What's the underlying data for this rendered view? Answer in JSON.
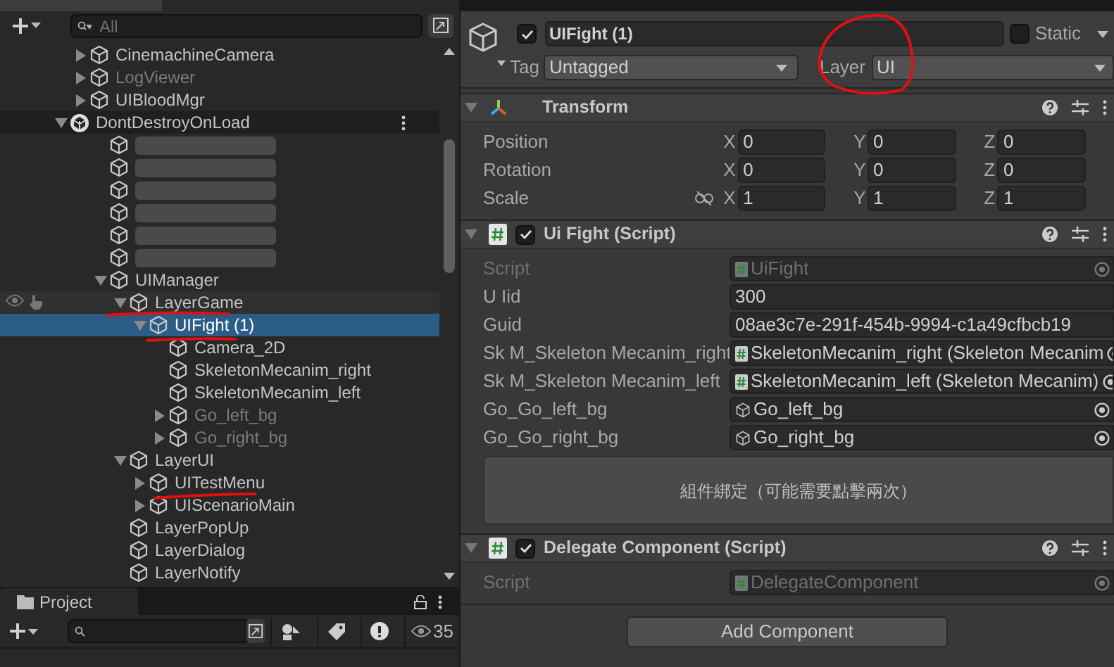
{
  "hierarchy": {
    "search": {
      "placeholder": "All"
    },
    "items": [
      {
        "kind": "object",
        "label": "CinemachineCamera",
        "expanded": false,
        "dimmed": false,
        "selected": false
      },
      {
        "kind": "object",
        "label": "LogViewer",
        "expanded": false,
        "dimmed": true,
        "selected": false
      },
      {
        "kind": "object",
        "label": "UIBloodMgr",
        "expanded": false,
        "dimmed": false,
        "selected": false
      },
      {
        "kind": "scene",
        "label": "DontDestroyOnLoad",
        "expanded": true,
        "dimmed": false,
        "selected": false,
        "children": [
          {
            "kind": "redacted"
          },
          {
            "kind": "redacted"
          },
          {
            "kind": "redacted"
          },
          {
            "kind": "redacted"
          },
          {
            "kind": "redacted"
          },
          {
            "kind": "redacted"
          },
          {
            "kind": "object",
            "label": "UIManager",
            "expanded": true,
            "dimmed": false,
            "selected": false,
            "children": [
              {
                "kind": "object",
                "label": "LayerGame",
                "expanded": true,
                "dimmed": false,
                "selected": false,
                "hovered": true,
                "children": [
                  {
                    "kind": "object",
                    "label": "UIFight (1)",
                    "expanded": true,
                    "dimmed": false,
                    "selected": true,
                    "children": [
                      {
                        "kind": "object",
                        "label": "Camera_2D",
                        "dimmed": false,
                        "selected": false
                      },
                      {
                        "kind": "object",
                        "label": "SkeletonMecanim_right",
                        "dimmed": false,
                        "selected": false
                      },
                      {
                        "kind": "object",
                        "label": "SkeletonMecanim_left",
                        "dimmed": false,
                        "selected": false
                      },
                      {
                        "kind": "object",
                        "label": "Go_left_bg",
                        "expanded": false,
                        "dimmed": true,
                        "selected": false
                      },
                      {
                        "kind": "object",
                        "label": "Go_right_bg",
                        "expanded": false,
                        "dimmed": true,
                        "selected": false
                      }
                    ]
                  }
                ]
              },
              {
                "kind": "object",
                "label": "LayerUI",
                "expanded": true,
                "dimmed": false,
                "selected": false,
                "children": [
                  {
                    "kind": "object",
                    "label": "UITestMenu",
                    "expanded": false,
                    "dimmed": false,
                    "selected": false
                  },
                  {
                    "kind": "object",
                    "label": "UIScenarioMain",
                    "expanded": false,
                    "dimmed": false,
                    "selected": false
                  }
                ]
              },
              {
                "kind": "object",
                "label": "LayerPopUp",
                "dimmed": false,
                "selected": false
              },
              {
                "kind": "object",
                "label": "LayerDialog",
                "dimmed": false,
                "selected": false
              },
              {
                "kind": "object",
                "label": "LayerNotify",
                "dimmed": false,
                "selected": false
              }
            ]
          }
        ]
      }
    ]
  },
  "project": {
    "tab": "Project",
    "count": "35"
  },
  "inspector": {
    "enabled": true,
    "name": "UIFight (1)",
    "static": false,
    "static_label": "Static",
    "tag_label": "Tag",
    "tag": "Untagged",
    "layer_label": "Layer",
    "layer": "UI",
    "transform": {
      "title": "Transform",
      "expanded": true,
      "rows": [
        {
          "label": "Position",
          "values": [
            {
              "axis": "X",
              "value": "0"
            },
            {
              "axis": "Y",
              "value": "0"
            },
            {
              "axis": "Z",
              "value": "0"
            }
          ]
        },
        {
          "label": "Rotation",
          "values": [
            {
              "axis": "X",
              "value": "0"
            },
            {
              "axis": "Y",
              "value": "0"
            },
            {
              "axis": "Z",
              "value": "0"
            }
          ]
        },
        {
          "label": "Scale",
          "proportional": false,
          "values": [
            {
              "axis": "X",
              "value": "1"
            },
            {
              "axis": "Y",
              "value": "1"
            },
            {
              "axis": "Z",
              "value": "1"
            }
          ]
        }
      ]
    },
    "components": [
      {
        "title": "Ui Fight (Script)",
        "enabled": true,
        "expanded": true,
        "fields": [
          {
            "kind": "script",
            "label": "Script",
            "value": "UiFight",
            "disabled": true
          },
          {
            "kind": "text",
            "label": "U Iid",
            "value": "300",
            "disabled": false
          },
          {
            "kind": "text",
            "label": "Guid",
            "value": "08ae3c7e-291f-454b-9994-c1a49cfbcb19",
            "disabled": false
          },
          {
            "kind": "component",
            "label": "Sk M_Skeleton Mecanim_right",
            "value": "SkeletonMecanim_right (Skeleton Mecanim",
            "disabled": false
          },
          {
            "kind": "component",
            "label": "Sk M_Skeleton Mecanim_left",
            "value": "SkeletonMecanim_left (Skeleton Mecanim)",
            "disabled": false
          },
          {
            "kind": "object",
            "label": "Go_Go_left_bg",
            "value": "Go_left_bg",
            "disabled": false
          },
          {
            "kind": "object",
            "label": "Go_Go_right_bg",
            "value": "Go_right_bg",
            "disabled": false
          }
        ],
        "button": "組件綁定（可能需要點擊兩次）"
      },
      {
        "title": "Delegate Component (Script)",
        "enabled": true,
        "expanded": true,
        "fields": [
          {
            "kind": "script",
            "label": "Script",
            "value": "DelegateComponent",
            "disabled": true
          }
        ]
      }
    ],
    "add_component": "Add Component"
  }
}
